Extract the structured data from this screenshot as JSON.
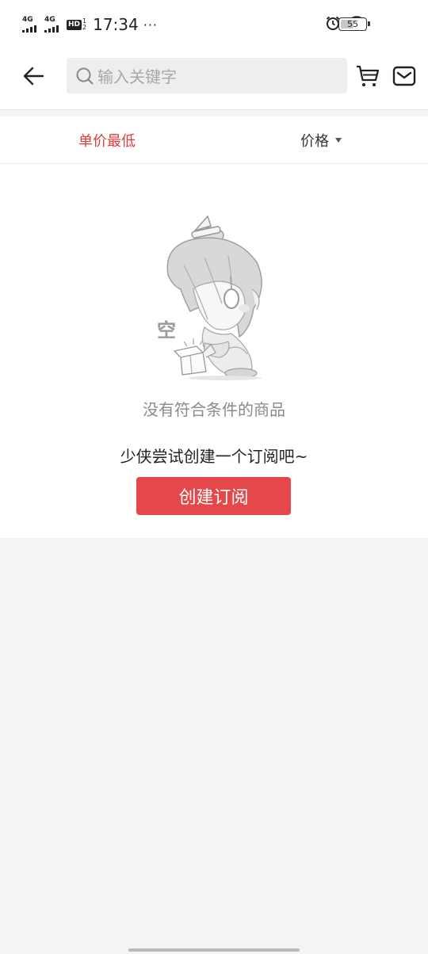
{
  "status_bar": {
    "network_1": "4G",
    "network_2": "4G",
    "hd_label": "HD",
    "hd_sub_top": "1",
    "hd_sub_bottom": "2",
    "time": "17:34",
    "more_dots": "···",
    "battery_level": "55",
    "icons": [
      "alarm-icon",
      "wifi-icon",
      "battery-icon"
    ]
  },
  "nav": {
    "search_placeholder": "输入关键字",
    "icons": [
      "back-arrow-icon",
      "search-icon",
      "cart-icon",
      "mail-icon"
    ]
  },
  "sort_bar": {
    "active_label": "单价最低",
    "price_label": "价格",
    "active_color": "#e03c3c"
  },
  "empty_state": {
    "badge_char": "空",
    "message": "没有符合条件的商品",
    "suggestion": "少侠尝试创建一个订阅吧~",
    "button_label": "创建订阅",
    "button_color": "#e5484a"
  }
}
